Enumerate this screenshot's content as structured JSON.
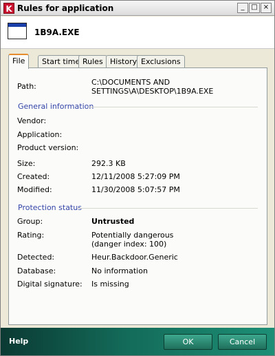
{
  "window": {
    "title": "Rules for application"
  },
  "header": {
    "filename": "1B9A.EXE"
  },
  "tabs": [
    {
      "label": "File"
    },
    {
      "label": "Start time"
    },
    {
      "label": "Rules"
    },
    {
      "label": "History"
    },
    {
      "label": "Exclusions"
    }
  ],
  "file": {
    "path_label": "Path:",
    "path_value": "C:\\DOCUMENTS AND SETTINGS\\A\\DESKTOP\\1B9A.EXE",
    "general_title": "General information",
    "vendor_label": "Vendor:",
    "application_label": "Application:",
    "product_version_label": "Product version:",
    "size_label": "Size:",
    "size_value": "292.3 KB",
    "created_label": "Created:",
    "created_value": "12/11/2008 5:27:09 PM",
    "modified_label": "Modified:",
    "modified_value": "11/30/2008 5:07:57 PM",
    "protection_title": "Protection status",
    "group_label": "Group:",
    "group_value": "Untrusted",
    "rating_label": "Rating:",
    "rating_value_1": "Potentially dangerous",
    "rating_value_2": "(danger index: 100)",
    "detected_label": "Detected:",
    "detected_value": "Heur.Backdoor.Generic",
    "database_label": "Database:",
    "database_value": "No information",
    "signature_label": "Digital signature:",
    "signature_value": "Is missing"
  },
  "footer": {
    "help": "Help",
    "ok": "OK",
    "cancel": "Cancel"
  },
  "titlebar": {
    "minimize": "_",
    "maximize": "□",
    "close": "×"
  },
  "app_icon": "K"
}
